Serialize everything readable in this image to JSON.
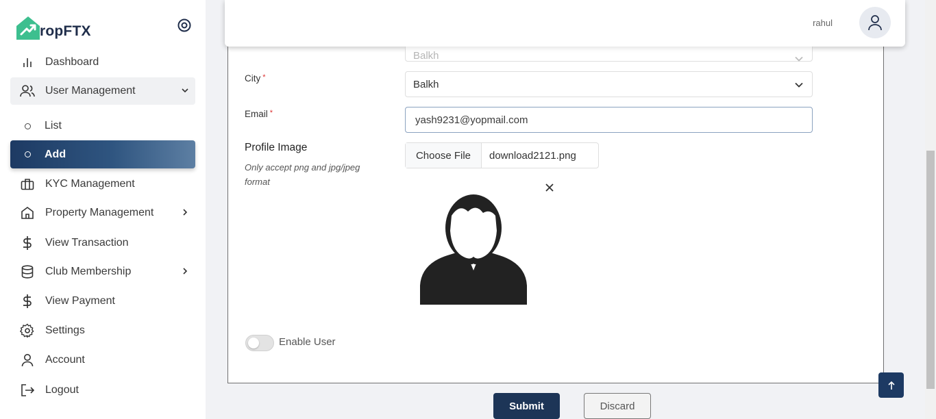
{
  "brand": {
    "name": "ropFTX"
  },
  "sidebar": {
    "items": [
      {
        "label": "Dashboard",
        "icon": "bar-chart-icon"
      },
      {
        "label": "User Management",
        "icon": "users-icon"
      },
      {
        "label": "List",
        "icon": "circle-icon"
      },
      {
        "label": "Add",
        "icon": "circle-icon"
      },
      {
        "label": "KYC Management",
        "icon": "briefcase-icon"
      },
      {
        "label": "Property Management",
        "icon": "home-icon"
      },
      {
        "label": "View Transaction",
        "icon": "dollar-icon"
      },
      {
        "label": "Club Membership",
        "icon": "database-icon"
      },
      {
        "label": "View Payment",
        "icon": "dollar-icon"
      },
      {
        "label": "Settings",
        "icon": "gear-icon"
      },
      {
        "label": "Account",
        "icon": "user-icon"
      },
      {
        "label": "Logout",
        "icon": "logout-icon"
      }
    ]
  },
  "header": {
    "username": "rahul"
  },
  "form": {
    "state_value": "Balkh",
    "city_label": "City",
    "city_value": "Balkh",
    "email_label": "Email",
    "required_mark": "*",
    "email_value": "yash9231@yopmail.com",
    "profile_label": "Profile Image",
    "profile_hint": "Only accept png and jpg/jpeg format",
    "file_button": "Choose File",
    "file_name": "download2121.png",
    "enable_user_label": "Enable User",
    "enable_user_on": false,
    "submit_label": "Submit",
    "discard_label": "Discard"
  },
  "colors": {
    "primary": "#1d3557",
    "active_gradient_start": "#1d3a63",
    "logo_green": "#3dbf8f",
    "required": "#d33333"
  }
}
